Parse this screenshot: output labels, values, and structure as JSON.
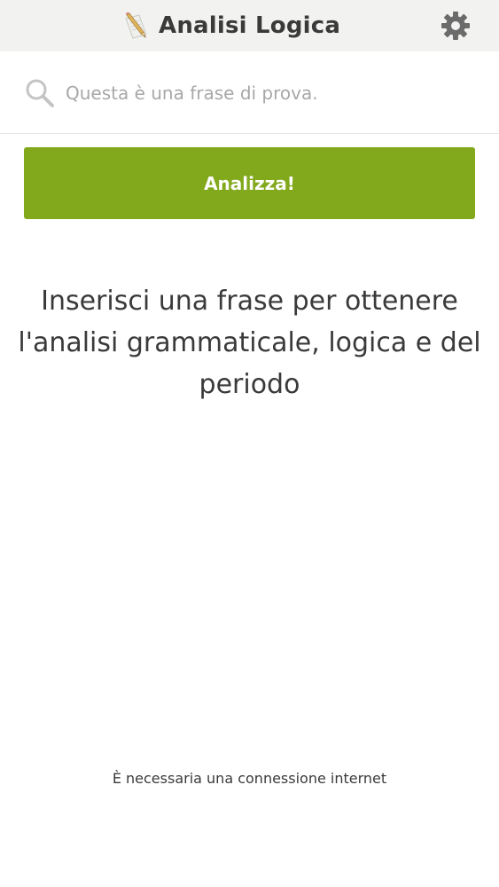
{
  "header": {
    "title": "Analisi Logica",
    "app_icon": "pencil-paper-icon",
    "settings_icon": "gear-icon"
  },
  "search": {
    "placeholder": "Questa è una frase di prova.",
    "value": "",
    "icon": "search-icon"
  },
  "actions": {
    "analyze_label": "Analizza!"
  },
  "main": {
    "instructions": "Inserisci una frase per ottenere l'analisi grammaticale, logica e del periodo"
  },
  "footer": {
    "note": "È necessaria una connessione internet"
  },
  "colors": {
    "accent": "#82a81c",
    "header_bg": "#f2f2f0",
    "text": "#3a3a3a",
    "placeholder": "#a8a8a8"
  }
}
